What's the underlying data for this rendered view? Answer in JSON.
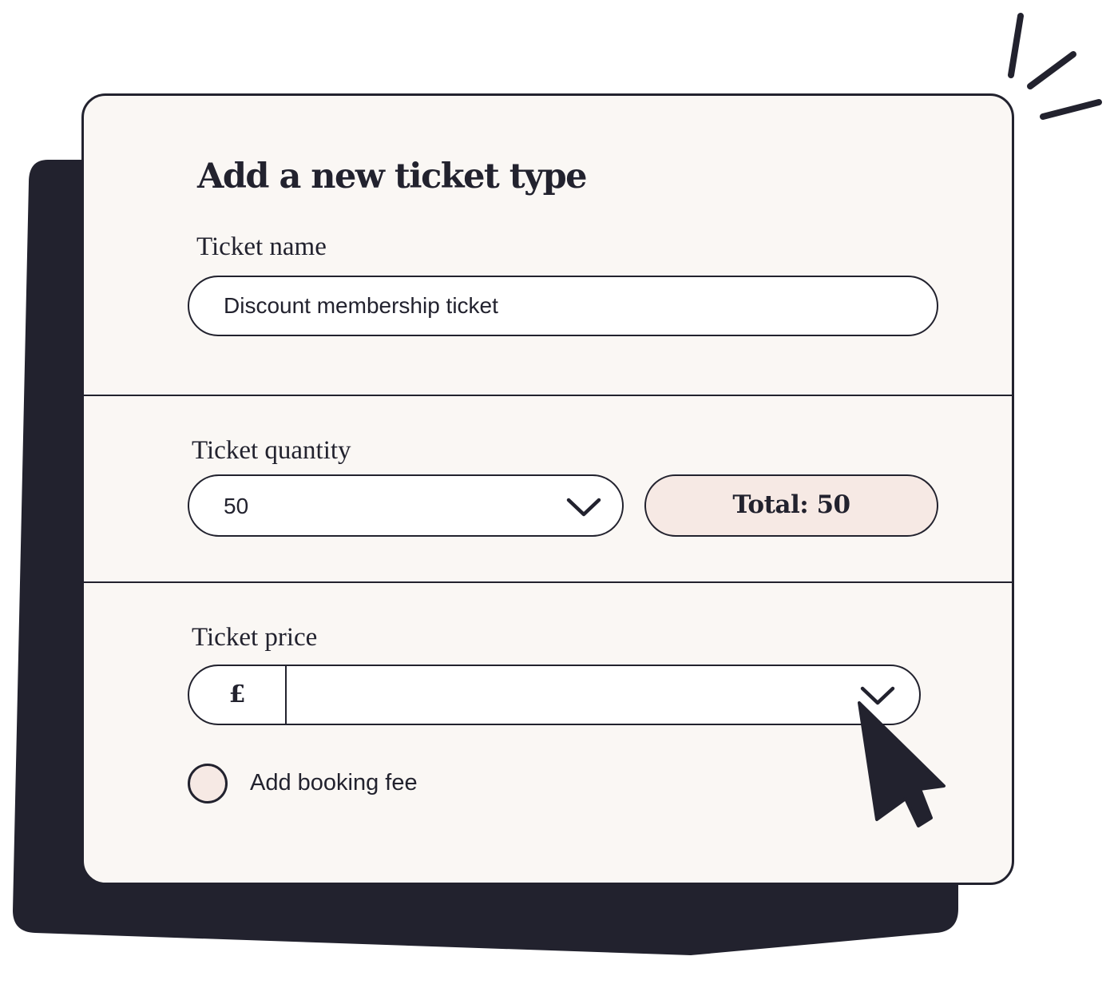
{
  "form": {
    "title": "Add a new ticket type",
    "ticket_name": {
      "label": "Ticket name",
      "value": "Discount membership ticket"
    },
    "ticket_quantity": {
      "label": "Ticket quantity",
      "selected": "50",
      "total_label": "Total: 50"
    },
    "ticket_price": {
      "label": "Ticket price",
      "currency": "£",
      "value": ""
    },
    "booking_fee": {
      "label": "Add booking fee",
      "checked": false
    }
  },
  "colors": {
    "ink": "#22222e",
    "card_background": "#faf7f4",
    "accent_pink": "#f6e9e4",
    "field_background": "#ffffff"
  },
  "icons": {
    "quantity_dropdown": "chevron-down-icon",
    "price_dropdown": "chevron-down-icon",
    "pointer": "mouse-pointer-icon",
    "decoration": "spark-lines-icon"
  }
}
